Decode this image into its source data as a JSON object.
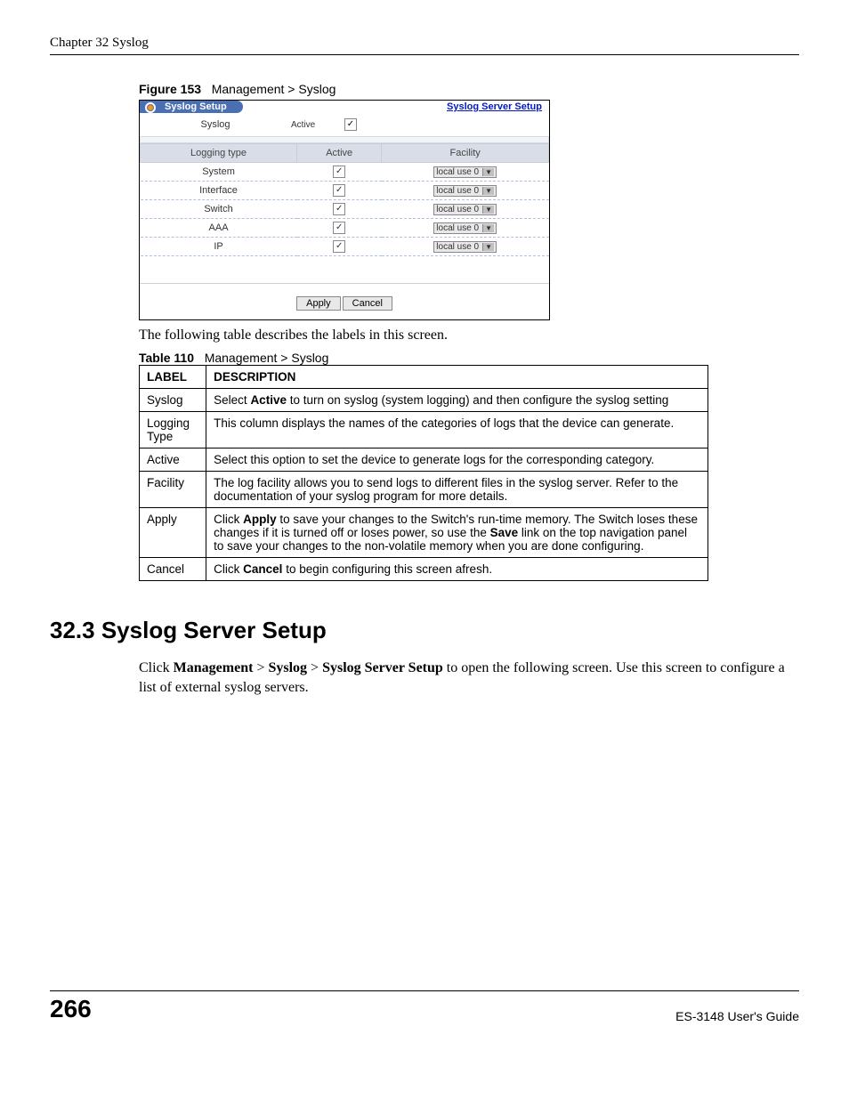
{
  "header": {
    "chapter": "Chapter 32 Syslog"
  },
  "figure": {
    "label": "Figure 153",
    "title": "Management > Syslog",
    "tab_title": "Syslog Setup",
    "link": "Syslog Server Setup",
    "syslog_label": "Syslog",
    "active_label": "Active",
    "columns": {
      "type": "Logging type",
      "active": "Active",
      "facility": "Facility"
    },
    "rows": [
      {
        "type": "System",
        "facility": "local use 0"
      },
      {
        "type": "Interface",
        "facility": "local use 0"
      },
      {
        "type": "Switch",
        "facility": "local use 0"
      },
      {
        "type": "AAA",
        "facility": "local use 0"
      },
      {
        "type": "IP",
        "facility": "local use 0"
      }
    ],
    "apply": "Apply",
    "cancel": "Cancel"
  },
  "para1": "The following table describes the labels in this screen.",
  "table_caption": {
    "label": "Table 110",
    "title": "Management > Syslog"
  },
  "table": {
    "head_label": "LABEL",
    "head_desc": "DESCRIPTION",
    "r0l": "Syslog",
    "r0d_a": "Select ",
    "r0d_b": "Active",
    "r0d_c": " to turn on syslog (system logging) and then configure the syslog setting",
    "r1l": "Logging Type",
    "r1d": "This column displays the names of the categories of logs that the device can generate.",
    "r2l": "Active",
    "r2d": "Select this option to set the device to generate logs for the corresponding category.",
    "r3l": "Facility",
    "r3d": "The log facility allows you to send logs to different files in the syslog server. Refer to the documentation of your syslog program for more details.",
    "r4l": "Apply",
    "r4d_a": "Click ",
    "r4d_b": "Apply",
    "r4d_c": " to save your changes to the Switch's run-time memory. The Switch loses these changes if it is turned off or loses power, so use the ",
    "r4d_d": "Save",
    "r4d_e": " link on the top navigation panel to save your changes to the non-volatile memory when you are done configuring.",
    "r5l": "Cancel",
    "r5d_a": "Click ",
    "r5d_b": "Cancel",
    "r5d_c": " to begin configuring this screen afresh."
  },
  "section": {
    "heading": "32.3  Syslog Server Setup",
    "p_a": "Click ",
    "p_b": "Management",
    "p_c": " > ",
    "p_d": "Syslog",
    "p_e": " > ",
    "p_f": "Syslog Server Setup",
    "p_g": " to open the following screen. Use this screen to configure a list of external syslog servers."
  },
  "footer": {
    "page": "266",
    "guide": "ES-3148 User's Guide"
  }
}
